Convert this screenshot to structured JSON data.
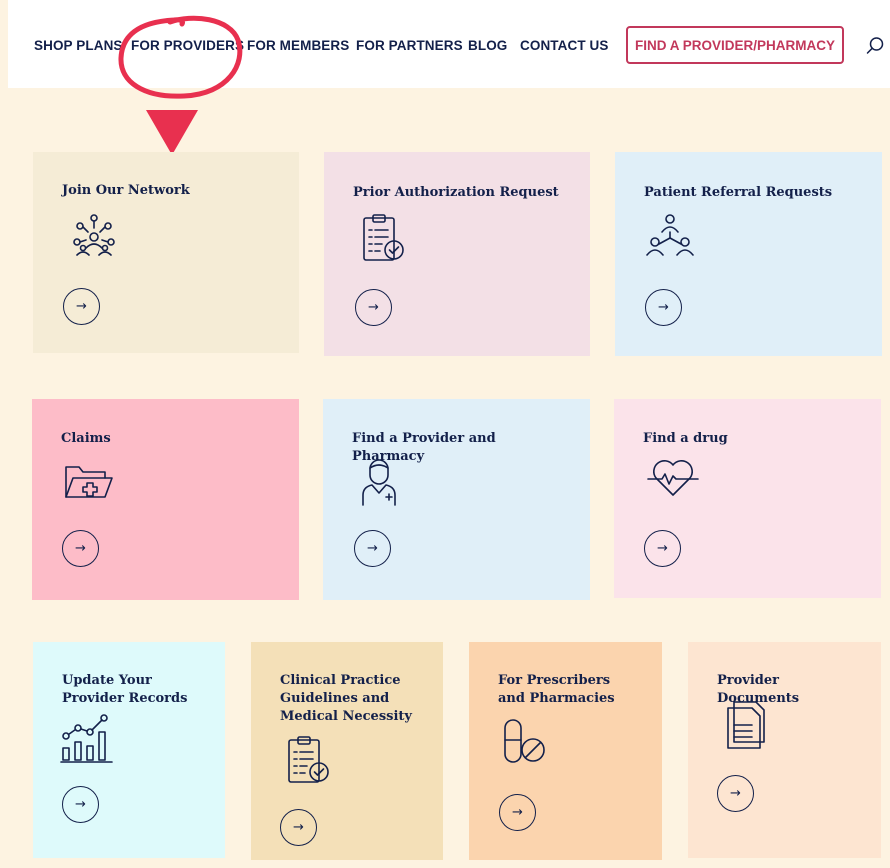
{
  "nav": {
    "items": [
      {
        "label": "SHOP PLANS"
      },
      {
        "label": "FOR PROVIDERS"
      },
      {
        "label": "FOR MEMBERS"
      },
      {
        "label": "FOR PARTNERS"
      },
      {
        "label": "BLOG"
      },
      {
        "label": "CONTACT US"
      }
    ],
    "cta_label": "FIND A PROVIDER/PHARMACY",
    "search_icon": "search-icon"
  },
  "colors": {
    "accent": "#c2385b",
    "navy": "#13204a",
    "annotation_red": "#e8304f",
    "page_background": "#fdf3e1"
  },
  "cards": [
    {
      "title": "Join Our Network",
      "icon": "network-people-icon",
      "color": "#f5ecd6"
    },
    {
      "title": "Prior Authorization Request",
      "icon": "clipboard-check-icon",
      "color": "#f3e0e6"
    },
    {
      "title": "Patient Referral Requests",
      "icon": "referral-people-icon",
      "color": "#e0eff8"
    },
    {
      "title": "Claims",
      "icon": "folder-medical-icon",
      "color": "#fdbcc8"
    },
    {
      "title": "Find a Provider and Pharmacy",
      "icon": "doctor-icon",
      "color": "#e0eff8"
    },
    {
      "title": "Find a drug",
      "icon": "heart-pulse-icon",
      "color": "#fbe3ea"
    },
    {
      "title": "Update Your Provider Records",
      "icon": "chart-growth-icon",
      "color": "#defafb"
    },
    {
      "title": "Clinical Practice Guidelines and Medical Necessity",
      "icon": "clipboard-check-icon",
      "color": "#f4e0b8"
    },
    {
      "title": "For Prescribers and Pharmacies",
      "icon": "pill-prohibited-icon",
      "color": "#fbd4ae"
    },
    {
      "title": "Provider Documents",
      "icon": "documents-icon",
      "color": "#fde5d1"
    }
  ],
  "arrow_glyph": "→"
}
